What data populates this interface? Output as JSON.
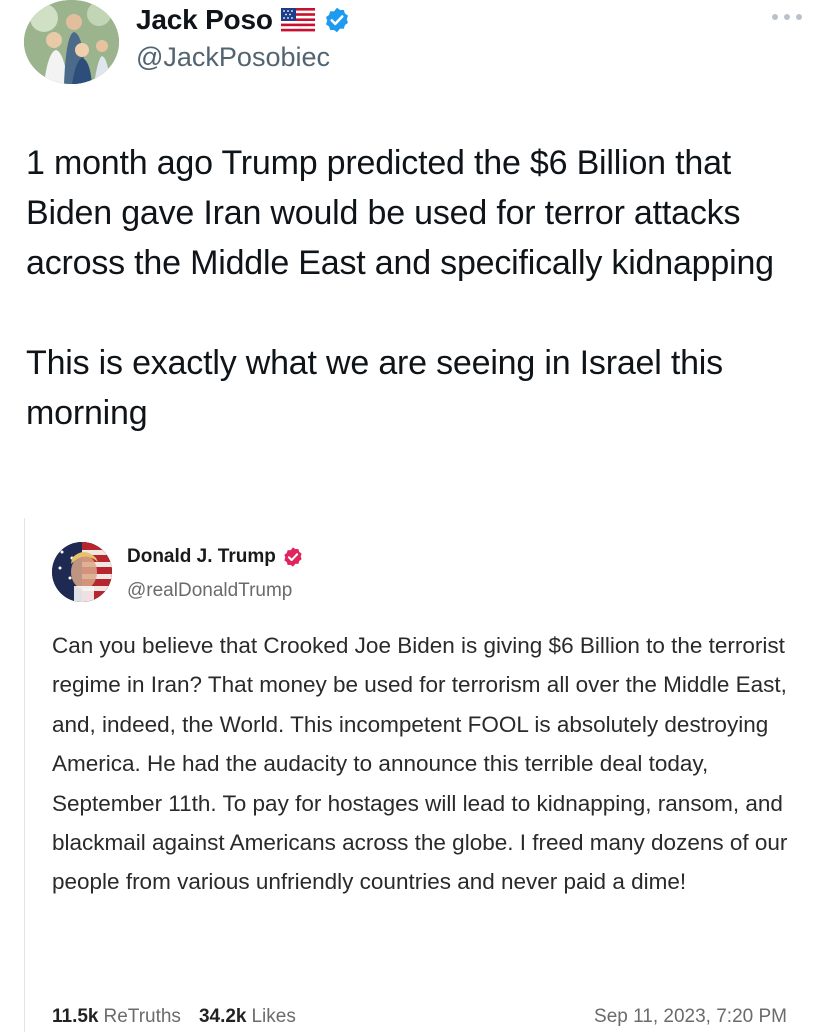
{
  "tweet": {
    "display_name": "Jack Poso",
    "handle": "@JackPosobiec",
    "flag_icon": "us-flag-icon",
    "verified_color": "#1d9bf0",
    "text": "1 month ago Trump predicted the $6 Billion that Biden gave Iran would be used for terror attacks across the Middle East and specifically kidnapping\n\nThis is exactly what we are seeing in Israel this morning"
  },
  "quote": {
    "display_name": "Donald J. Trump",
    "handle": "@realDonaldTrump",
    "verified_color": "#e0245e",
    "body": "Can you believe that Crooked Joe Biden is giving $6 Billion to the terrorist regime in Iran? That money be used for terrorism all over the Middle East, and, indeed, the World. This incompetent FOOL is absolutely destroying America. He had the audacity to announce this terrible deal today, September 11th. To pay for hostages will lead to kidnapping, ransom, and blackmail against Americans across the globe. I freed many dozens of our people from various unfriendly countries and never paid a dime!",
    "retruths_count": "11.5k",
    "retruths_label": "ReTruths",
    "likes_count": "34.2k",
    "likes_label": "Likes",
    "timestamp": "Sep 11, 2023, 7:20 PM"
  }
}
